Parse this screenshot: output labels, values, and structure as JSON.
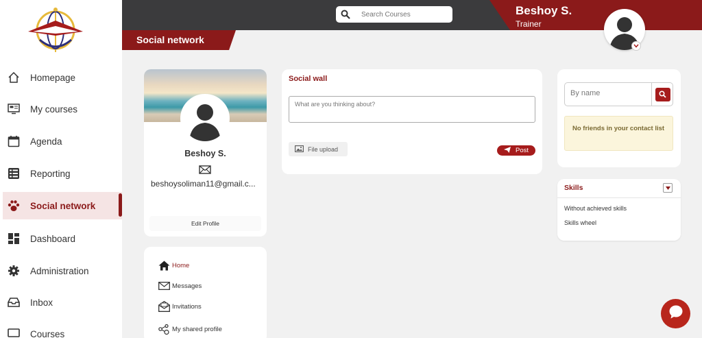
{
  "sidebar": {
    "items": [
      {
        "label": "Homepage",
        "icon": "home-icon"
      },
      {
        "label": "My courses",
        "icon": "courses-icon"
      },
      {
        "label": "Agenda",
        "icon": "calendar-icon"
      },
      {
        "label": "Reporting",
        "icon": "reporting-icon"
      },
      {
        "label": "Social network",
        "icon": "paw-icon",
        "active": true
      },
      {
        "label": "Dashboard",
        "icon": "dashboard-icon"
      },
      {
        "label": "Administration",
        "icon": "gear-icon"
      },
      {
        "label": "Inbox",
        "icon": "inbox-icon"
      },
      {
        "label": "Courses",
        "icon": "monitor-icon"
      }
    ]
  },
  "header": {
    "search_placeholder": "Search Courses",
    "user_name": "Beshoy S.",
    "user_role": "Trainer",
    "page_title": "Social network"
  },
  "profile": {
    "name": "Beshoy S.",
    "email": "beshoysoliman11@gmail.c...",
    "edit_label": "Edit Profile"
  },
  "profile_menu": {
    "items": [
      {
        "label": "Home",
        "icon": "home-icon",
        "active": true
      },
      {
        "label": "Messages",
        "icon": "envelope-icon"
      },
      {
        "label": "Invitations",
        "icon": "invitation-icon"
      },
      {
        "label": "My shared profile",
        "icon": "share-icon"
      }
    ]
  },
  "wall": {
    "title": "Social wall",
    "placeholder": "What are you thinking about?",
    "upload_label": "File upload",
    "post_label": "Post"
  },
  "friends": {
    "search_placeholder": "By name",
    "empty_message": "No friends in your contact list"
  },
  "skills": {
    "title": "Skills",
    "items": [
      "Without achieved skills",
      "Skills wheel"
    ]
  },
  "colors": {
    "accent": "#8b1a1a",
    "topbar": "#3b3b3d",
    "button": "#a61c1c"
  }
}
